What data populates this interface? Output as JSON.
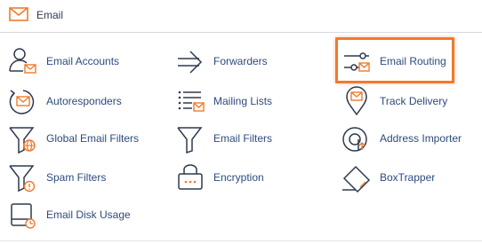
{
  "header": {
    "title": "Email",
    "icon": "envelope-icon"
  },
  "colors": {
    "accent": "#f07a2c",
    "icon_stroke": "#2e3a4e",
    "link": "#2d4b7c"
  },
  "items": [
    {
      "label": "Email Accounts",
      "icon": "email-accounts-icon"
    },
    {
      "label": "Forwarders",
      "icon": "forwarders-icon"
    },
    {
      "label": "Email Routing",
      "icon": "email-routing-icon",
      "highlighted": true
    },
    {
      "label": "Autoresponders",
      "icon": "autoresponders-icon"
    },
    {
      "label": "Mailing Lists",
      "icon": "mailing-lists-icon"
    },
    {
      "label": "Track Delivery",
      "icon": "track-delivery-icon"
    },
    {
      "label": "Global Email Filters",
      "icon": "global-email-filters-icon"
    },
    {
      "label": "Email Filters",
      "icon": "email-filters-icon"
    },
    {
      "label": "Address Importer",
      "icon": "address-importer-icon"
    },
    {
      "label": "Spam Filters",
      "icon": "spam-filters-icon"
    },
    {
      "label": "Encryption",
      "icon": "encryption-icon"
    },
    {
      "label": "BoxTrapper",
      "icon": "boxtrapper-icon"
    },
    {
      "label": "Email Disk Usage",
      "icon": "email-disk-usage-icon"
    }
  ]
}
